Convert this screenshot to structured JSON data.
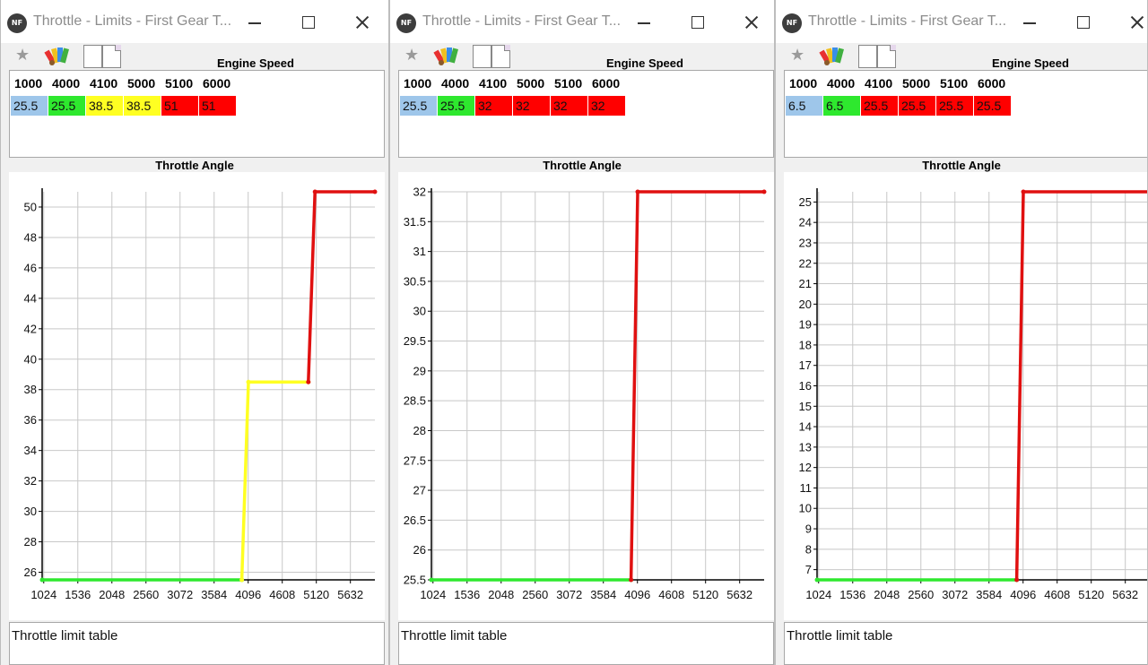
{
  "windows": [
    {
      "title": "Throttle - Limits - First Gear T...",
      "app_icon_text": "NF",
      "engine_speed_label": "Engine Speed",
      "throttle_angle_label": "Throttle Angle",
      "description": "Throttle limit table",
      "table": {
        "headers": [
          "1000",
          "4000",
          "4100",
          "5000",
          "5100",
          "6000"
        ],
        "values": [
          {
            "text": "25.5",
            "color": "#9ec6ea"
          },
          {
            "text": "25.5",
            "color": "#2ee82e"
          },
          {
            "text": "38.5",
            "color": "#ffff22"
          },
          {
            "text": "38.5",
            "color": "#ffff22"
          },
          {
            "text": "51",
            "color": "#ff0000"
          },
          {
            "text": "51",
            "color": "#ff0000"
          }
        ]
      },
      "chart_data": {
        "type": "line",
        "xlabel": "",
        "ylabel": "",
        "x_ticks": [
          "1024",
          "1536",
          "2048",
          "2560",
          "3072",
          "3584",
          "4096",
          "4608",
          "5120",
          "5632"
        ],
        "y_ticks": [
          "26",
          "28",
          "30",
          "32",
          "34",
          "36",
          "38",
          "40",
          "42",
          "44",
          "46",
          "48",
          "50"
        ],
        "xlim": [
          1000,
          6000
        ],
        "ylim": [
          25.5,
          51
        ],
        "series": [
          {
            "color": "#2ee82e",
            "x": [
              1000,
              4000
            ],
            "y": [
              25.5,
              25.5
            ]
          },
          {
            "color": "#ffff22",
            "x": [
              4000,
              4100,
              5000
            ],
            "y": [
              25.5,
              38.5,
              38.5
            ]
          },
          {
            "color": "#e01010",
            "x": [
              5000,
              5100,
              6000
            ],
            "y": [
              38.5,
              51,
              51
            ]
          }
        ]
      }
    },
    {
      "title": "Throttle - Limits - First Gear T...",
      "app_icon_text": "NF",
      "engine_speed_label": "Engine Speed",
      "throttle_angle_label": "Throttle Angle",
      "description": "Throttle limit table",
      "table": {
        "headers": [
          "1000",
          "4000",
          "4100",
          "5000",
          "5100",
          "6000"
        ],
        "values": [
          {
            "text": "25.5",
            "color": "#9ec6ea"
          },
          {
            "text": "25.5",
            "color": "#2ee82e"
          },
          {
            "text": "32",
            "color": "#ff0000"
          },
          {
            "text": "32",
            "color": "#ff0000"
          },
          {
            "text": "32",
            "color": "#ff0000"
          },
          {
            "text": "32",
            "color": "#ff0000"
          }
        ]
      },
      "chart_data": {
        "type": "line",
        "xlabel": "",
        "ylabel": "",
        "x_ticks": [
          "1024",
          "1536",
          "2048",
          "2560",
          "3072",
          "3584",
          "4096",
          "4608",
          "5120",
          "5632"
        ],
        "y_ticks": [
          "25.5",
          "26",
          "26.5",
          "27",
          "27.5",
          "28",
          "28.5",
          "29",
          "29.5",
          "30",
          "30.5",
          "31",
          "31.5",
          "32"
        ],
        "xlim": [
          1000,
          6000
        ],
        "ylim": [
          25.5,
          32
        ],
        "series": [
          {
            "color": "#2ee82e",
            "x": [
              1000,
              4000
            ],
            "y": [
              25.5,
              25.5
            ]
          },
          {
            "color": "#e01010",
            "x": [
              4000,
              4100,
              6000
            ],
            "y": [
              25.5,
              32,
              32
            ]
          }
        ]
      }
    },
    {
      "title": "Throttle - Limits - First Gear T...",
      "app_icon_text": "NF",
      "engine_speed_label": "Engine Speed",
      "throttle_angle_label": "Throttle Angle",
      "description": "Throttle limit table",
      "table": {
        "headers": [
          "1000",
          "4000",
          "4100",
          "5000",
          "5100",
          "6000"
        ],
        "values": [
          {
            "text": "6.5",
            "color": "#9ec6ea"
          },
          {
            "text": "6.5",
            "color": "#2ee82e"
          },
          {
            "text": "25.5",
            "color": "#ff0000"
          },
          {
            "text": "25.5",
            "color": "#ff0000"
          },
          {
            "text": "25.5",
            "color": "#ff0000"
          },
          {
            "text": "25.5",
            "color": "#ff0000"
          }
        ]
      },
      "chart_data": {
        "type": "line",
        "xlabel": "",
        "ylabel": "",
        "x_ticks": [
          "1024",
          "1536",
          "2048",
          "2560",
          "3072",
          "3584",
          "4096",
          "4608",
          "5120",
          "5632"
        ],
        "y_ticks": [
          "7",
          "8",
          "9",
          "10",
          "11",
          "12",
          "13",
          "14",
          "15",
          "16",
          "17",
          "18",
          "19",
          "20",
          "21",
          "22",
          "23",
          "24",
          "25"
        ],
        "xlim": [
          1000,
          6000
        ],
        "ylim": [
          6.5,
          25.5
        ],
        "series": [
          {
            "color": "#2ee82e",
            "x": [
              1000,
              4000
            ],
            "y": [
              6.5,
              6.5
            ]
          },
          {
            "color": "#e01010",
            "x": [
              4000,
              4100,
              6000
            ],
            "y": [
              6.5,
              25.5,
              25.5
            ]
          }
        ]
      }
    }
  ]
}
